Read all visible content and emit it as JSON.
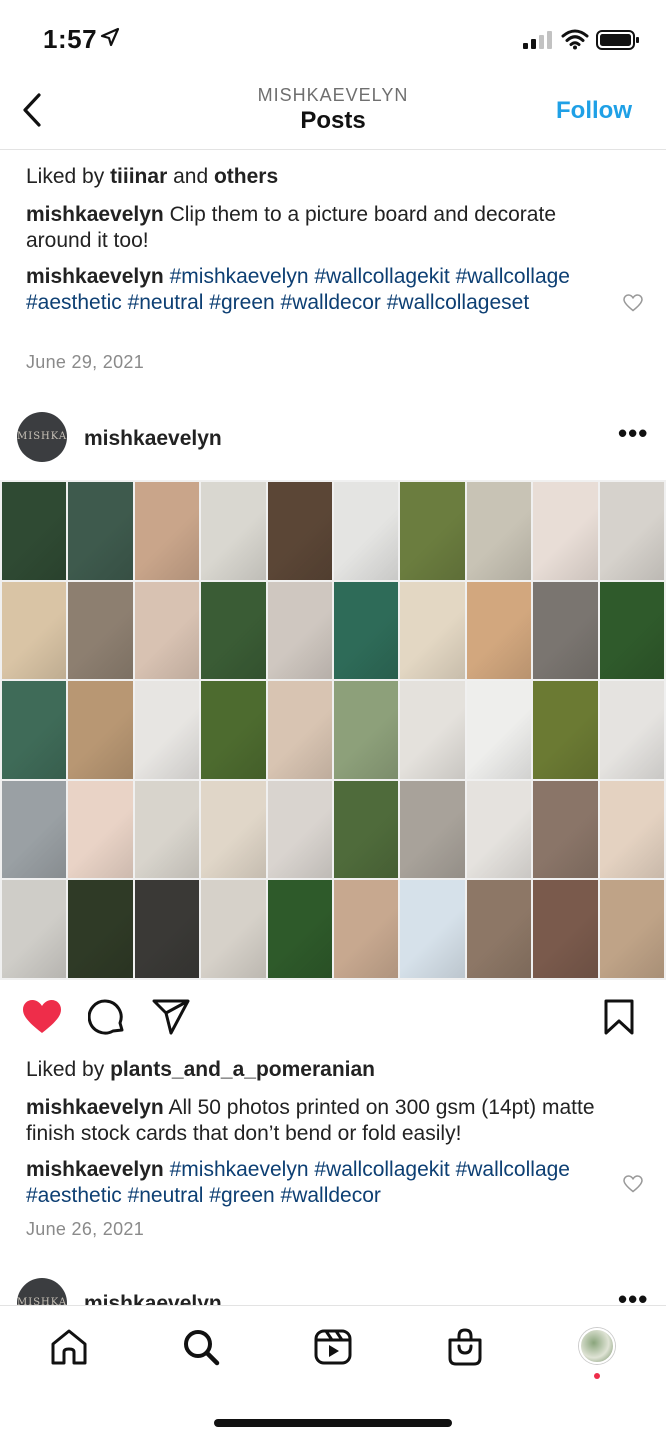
{
  "status": {
    "time": "1:57"
  },
  "nav": {
    "account": "MISHKAEVELYN",
    "title": "Posts",
    "follow": "Follow"
  },
  "post1": {
    "liked_prefix": "Liked by ",
    "liked_user": "tiiinar",
    "liked_mid": " and ",
    "liked_others": "others",
    "caption_user": "mishkaevelyn",
    "caption_text": " Clip them to a picture board and decorate around it too!",
    "comment_user": "mishkaevelyn",
    "hashtags": "#mishkaevelyn #wallcollagekit #wallcollage #aesthetic #neutral #green #walldecor #wallcollageset",
    "date": "June 29, 2021"
  },
  "post2": {
    "username": "mishkaevelyn",
    "avatar_text": "MISHKA EVELYN",
    "liked_prefix": "Liked by ",
    "liked_user": "plants_and_a_pomeranian",
    "caption_user": "mishkaevelyn",
    "caption_text": " All 50 photos printed on 300 gsm (14pt) matte finish stock cards that don’t bend or fold easily!",
    "comment_user": "mishkaevelyn",
    "hashtags": "#mishkaevelyn #wallcollagekit #wallcollage #aesthetic #neutral #green #walldecor",
    "date": "June 26, 2021",
    "liked": true
  },
  "post3": {
    "username": "mishkaevelyn",
    "avatar_text": "MISHKA"
  },
  "colors": {
    "accent": "#1fa0e6",
    "hashtag": "#0d3f73",
    "heart": "#ee2d4a"
  },
  "grid_colors": [
    "#2f4a33",
    "#3e5a4d",
    "#c9a58a",
    "#d9d7d0",
    "#5b4636",
    "#e4e4e2",
    "#6b7d3f",
    "#c8c3b5",
    "#e8ddd6",
    "#d6d2cc",
    "#d9c4a5",
    "#8d7f70",
    "#d8c2b2",
    "#3a5c35",
    "#cfc7c0",
    "#2e6b58",
    "#e3d7c3",
    "#d2a77e",
    "#7a7570",
    "#2f5a2b",
    "#3f6b58",
    "#b89773",
    "#e7e5e2",
    "#4d6b2f",
    "#d8c4b2",
    "#8da07a",
    "#e4e1dc",
    "#eeeeec",
    "#6b7a33",
    "#e5e3e0",
    "#9aa0a4",
    "#e9d3c6",
    "#d8d4cc",
    "#e0d6c8",
    "#d9d4cf",
    "#4f6b3b",
    "#a8a29a",
    "#e5e2de",
    "#8a7568",
    "#e4d2c1",
    "#cfcdc8",
    "#2f3a26",
    "#3a3936",
    "#d6d1c9",
    "#2e5a2a",
    "#c7a88f",
    "#d6e1ea",
    "#8d7766",
    "#7a5a4c",
    "#bfa387"
  ],
  "icons": {
    "back": "chevron-left-icon",
    "heart": "heart-icon",
    "comment": "comment-icon",
    "share": "paper-plane-icon",
    "save": "bookmark-icon",
    "home": "home-icon",
    "search": "search-icon",
    "reels": "reels-icon",
    "shop": "shop-icon"
  }
}
